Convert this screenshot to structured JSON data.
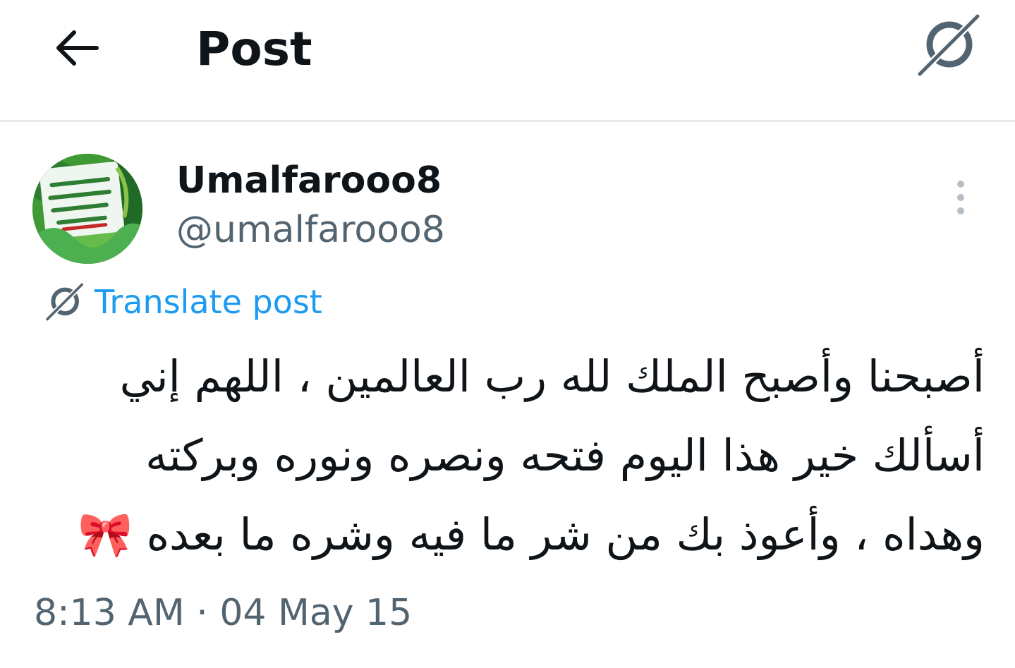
{
  "header": {
    "title": "Post",
    "back_icon": "arrow-left-icon",
    "grok_icon": "grok-icon"
  },
  "post": {
    "author": {
      "display_name": "Umalfarooo8",
      "handle": "@umalfarooo8",
      "avatar_icon": "avatar-image"
    },
    "more_icon": "more-vertical-icon",
    "translate": {
      "label": "Translate post",
      "icon": "grok-icon"
    },
    "text_lines": [
      "أصبحنا وأصبح الملك لله رب العالمين ، اللهم إني",
      "أسألك خير هذا اليوم فتحه ونصره ونوره وبركته",
      "وهداه ، وأعوذ بك من شر ما فيه وشره ما بعده 🎀"
    ],
    "timestamp": "8:13 AM · 04 May 15"
  },
  "colors": {
    "accent": "#1d9bf0",
    "text_primary": "#0f1419",
    "text_secondary": "#536471",
    "divider": "#e6e9ec",
    "ribbon": "#f48fb1"
  }
}
